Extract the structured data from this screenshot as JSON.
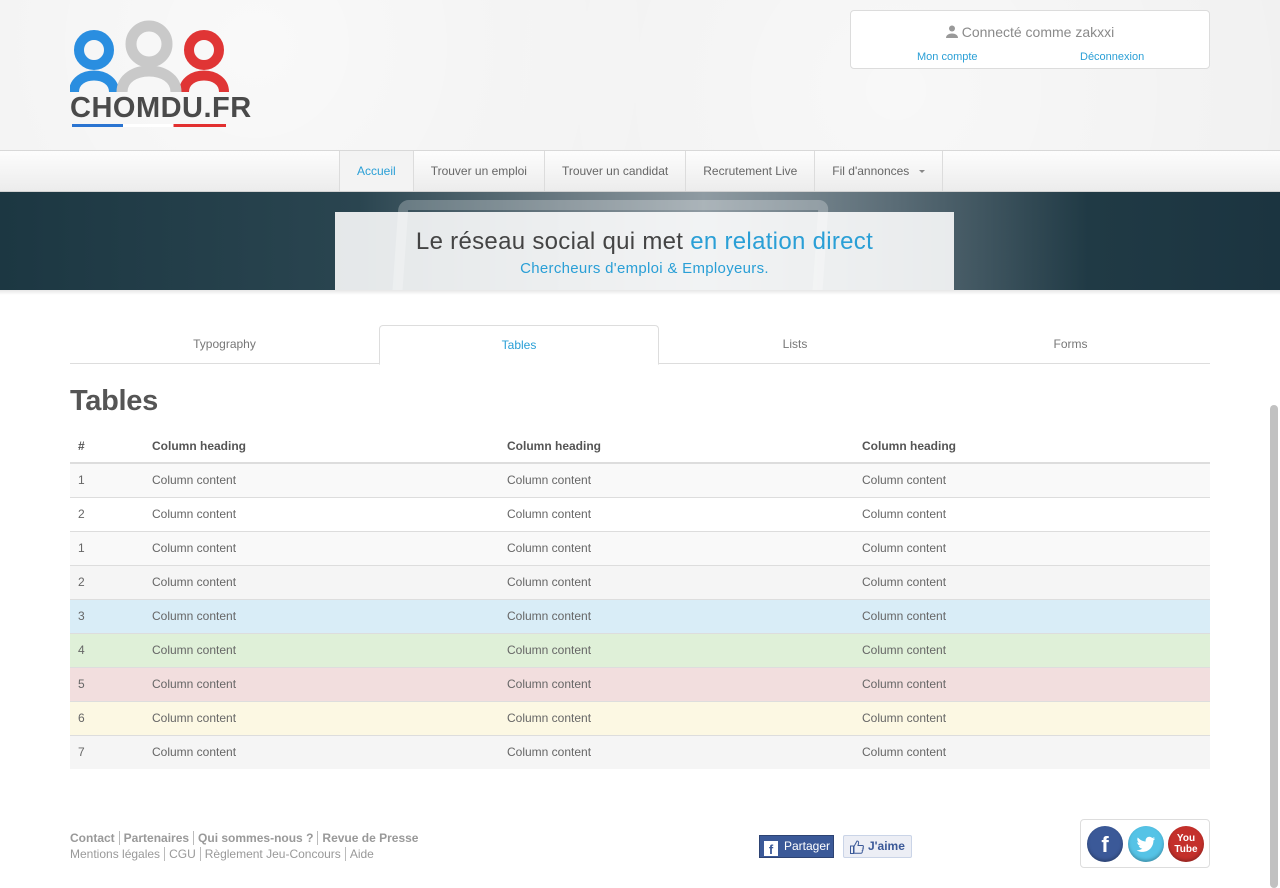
{
  "header": {
    "logo_text": "CHOMDU.FR",
    "account": {
      "user_label": "Connecté comme zakxxi",
      "my_account": "Mon compte",
      "logout": "Déconnexion"
    }
  },
  "nav": {
    "items": [
      {
        "label": "Accueil",
        "active": true
      },
      {
        "label": "Trouver un emploi"
      },
      {
        "label": "Trouver un candidat"
      },
      {
        "label": "Recrutement Live"
      },
      {
        "label": "Fil d'annonces",
        "dropdown": true
      }
    ]
  },
  "banner": {
    "line1_prefix": "Le réseau social qui met ",
    "line1_highlight": "en relation direct",
    "line2": "Chercheurs d'emploi & Employeurs."
  },
  "tabs": [
    {
      "label": "Typography"
    },
    {
      "label": "Tables",
      "active": true
    },
    {
      "label": "Lists"
    },
    {
      "label": "Forms"
    }
  ],
  "section": {
    "title": "Tables"
  },
  "table": {
    "headers": [
      "#",
      "Column heading",
      "Column heading",
      "Column heading"
    ],
    "rows": [
      {
        "num": "1",
        "cells": [
          "Column content",
          "Column content",
          "Column content"
        ],
        "style": "plain"
      },
      {
        "num": "2",
        "cells": [
          "Column content",
          "Column content",
          "Column content"
        ],
        "style": "odd"
      },
      {
        "num": "1",
        "cells": [
          "Column content",
          "Column content",
          "Column content"
        ],
        "style": "plain"
      },
      {
        "num": "2",
        "cells": [
          "Column content",
          "Column content",
          "Column content"
        ],
        "style": "last"
      },
      {
        "num": "3",
        "cells": [
          "Column content",
          "Column content",
          "Column content"
        ],
        "style": "info"
      },
      {
        "num": "4",
        "cells": [
          "Column content",
          "Column content",
          "Column content"
        ],
        "style": "success"
      },
      {
        "num": "5",
        "cells": [
          "Column content",
          "Column content",
          "Column content"
        ],
        "style": "danger"
      },
      {
        "num": "6",
        "cells": [
          "Column content",
          "Column content",
          "Column content"
        ],
        "style": "warning"
      },
      {
        "num": "7",
        "cells": [
          "Column content",
          "Column content",
          "Column content"
        ],
        "style": "last"
      }
    ]
  },
  "footer": {
    "links_row1": [
      "Contact",
      "Partenaires",
      "Qui sommes-nous ?",
      "Revue de Presse"
    ],
    "links_row2": [
      "Mentions légales",
      "CGU",
      "Règlement Jeu-Concours",
      "Aide"
    ],
    "share_label": "Partager",
    "like_label": "J'aime",
    "social": [
      {
        "name": "facebook",
        "icon": "facebook-icon"
      },
      {
        "name": "twitter",
        "icon": "twitter-icon"
      },
      {
        "name": "youtube",
        "icon": "youtube-icon",
        "line1": "You",
        "line2": "Tube"
      }
    ]
  },
  "colors": {
    "accent": "#2a9fd6",
    "info": "#d9edf7",
    "success": "#dff0d8",
    "danger": "#f2dede",
    "warning": "#fcf8e3"
  }
}
